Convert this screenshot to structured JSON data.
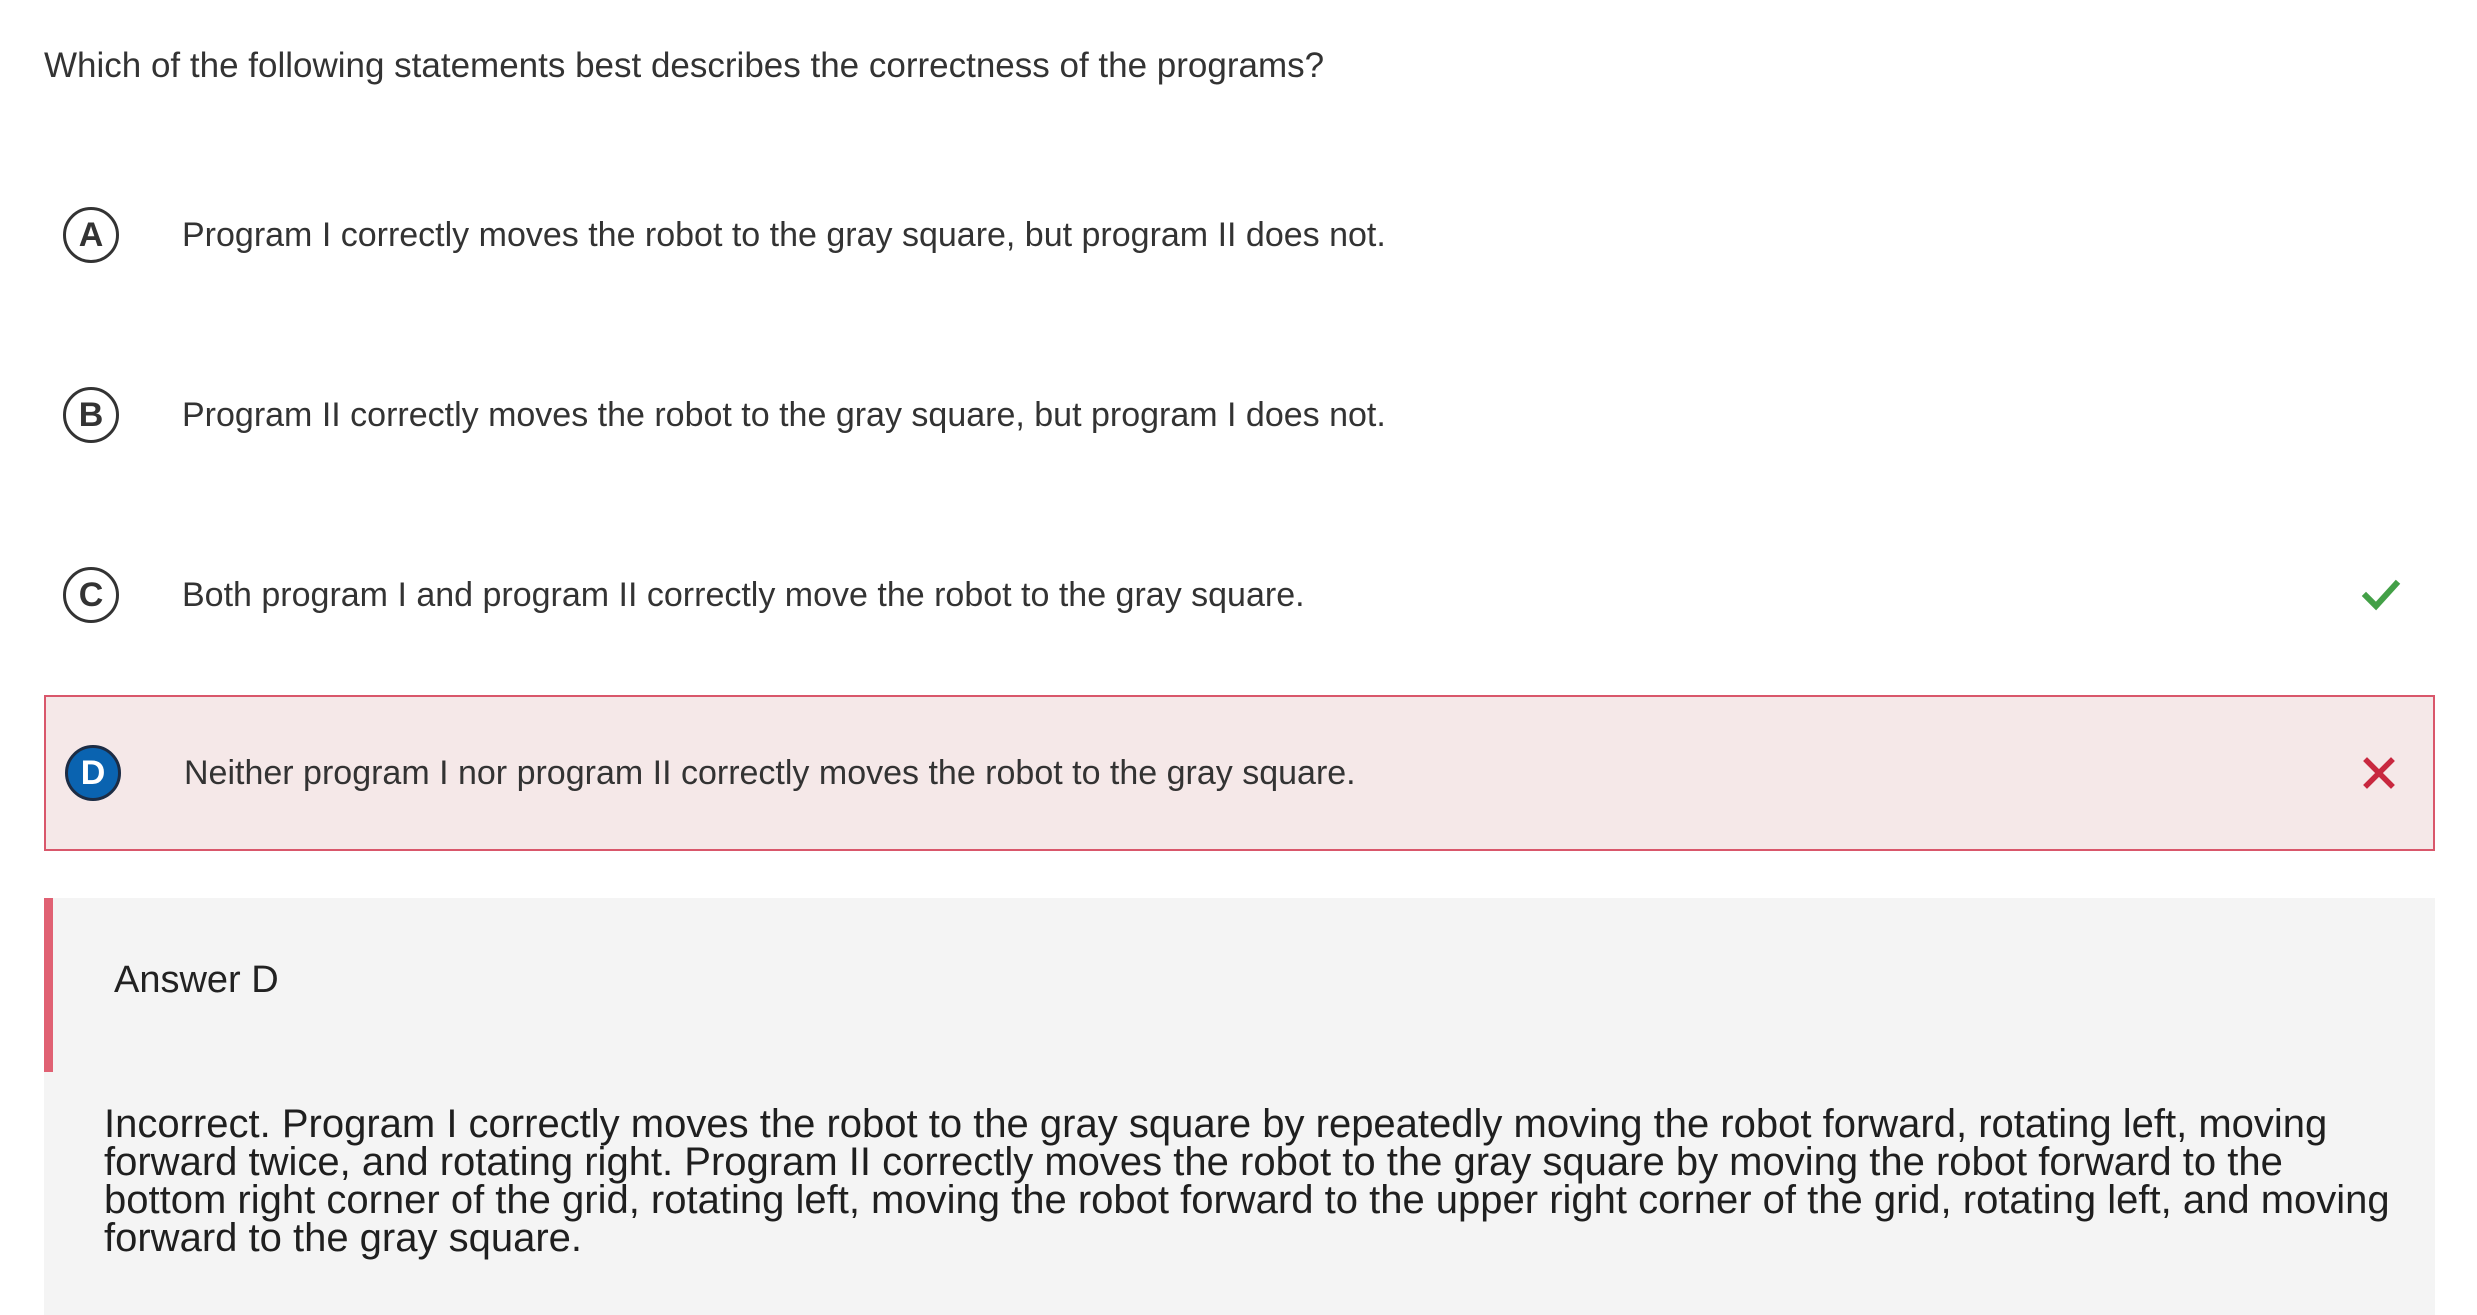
{
  "question": "Which of the following statements best describes the correctness of the programs?",
  "options": [
    {
      "letter": "A",
      "text": "Program I correctly moves the robot to the gray square, but program II does not."
    },
    {
      "letter": "B",
      "text": "Program II correctly moves the robot to the gray square, but program I does not."
    },
    {
      "letter": "C",
      "text": "Both program I and program II correctly move the robot to the gray square.",
      "mark": "check-icon"
    },
    {
      "letter": "D",
      "text": "Neither program I nor program II correctly moves the robot to the gray square.",
      "mark": "cross-icon"
    }
  ],
  "feedback": {
    "title": "Answer D",
    "text": "Incorrect. Program I correctly moves the robot to the gray square by repeatedly moving the robot forward, rotating left, moving forward twice, and rotating right. Program II correctly moves the robot to the gray square by moving the robot forward to the bottom right corner of the grid, rotating left, moving the robot forward to the upper right corner of the grid, rotating left, and moving forward to the gray square."
  },
  "colors": {
    "correct": "#43a047",
    "incorrect": "#c8283f",
    "selected_background": "#f5e8e8",
    "selected_border": "#d9576b",
    "selected_letter": "#0a63b0",
    "feedback_bar": "#e06173",
    "feedback_background": "#f4f4f4"
  }
}
